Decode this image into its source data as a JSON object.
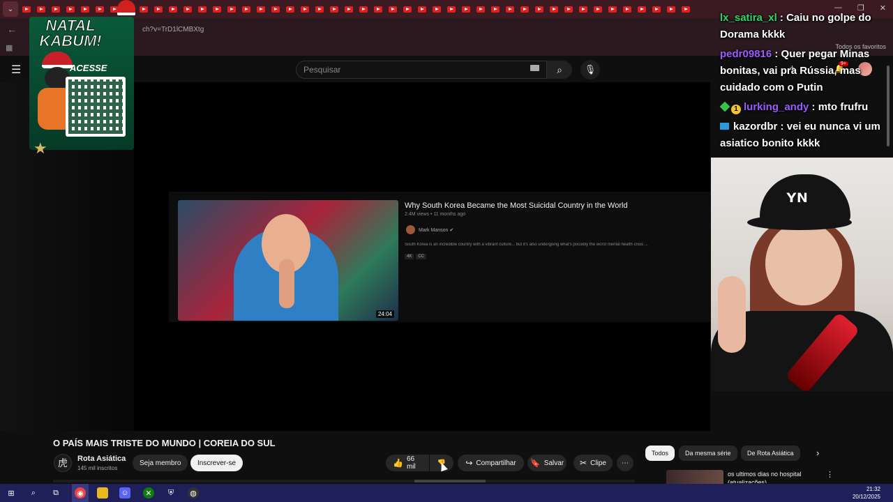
{
  "browser": {
    "url": "ch?v=TrD1lCMBXtg",
    "bookmarks_all": "Todos os favoritos"
  },
  "youtube": {
    "search_placeholder": "Pesquisar",
    "notifications_badge": "9+"
  },
  "end_card": {
    "title": "Why South Korea Became the Most Suicidal Country in the World",
    "meta": "2.4M views • 11 months ago",
    "channel": "Mark Manson",
    "description": "South Korea is an incredible country with a vibrant culture... but it's also undergoing what's possibly the worst mental health crisis ...",
    "badges": [
      "4K",
      "CC"
    ],
    "duration": "24:04"
  },
  "video": {
    "title": "O PAÍS MAIS TRISTE DO MUNDO | COREIA DO SUL",
    "channel_name": "Rota Asiática",
    "subscribers": "145 mil inscritos",
    "member_label": "Seja membro",
    "subscribe_label": "Inscrever-se",
    "likes": "66 mil",
    "share_label": "Compartilhar",
    "save_label": "Salvar",
    "clip_label": "Clipe"
  },
  "chips": {
    "all": "Todos",
    "series": "Da mesma série",
    "channel": "De Rota Asiática"
  },
  "recommended": {
    "title": "os ultimos dias no hospital (atualizações)"
  },
  "overlay": {
    "kabum_title": "NATAL KABUM!",
    "kabum_cta": "ACESSE"
  },
  "chat": [
    {
      "user": "lx_satira_xl",
      "text": " : Caiu no golpe do Dorama kkkk"
    },
    {
      "user": "pedr09816",
      "text": " : Quer pegar Minas bonitas, vai pra Rússia, mas cuidado com o Putin"
    },
    {
      "user": "lurking_andy",
      "text": " : mto frufru"
    },
    {
      "user": "kazordbr",
      "text": " : vei eu nunca vi um asiatico bonito kkkk"
    }
  ],
  "taskbar": {
    "time": "21:32",
    "date": "20/12/2025"
  }
}
